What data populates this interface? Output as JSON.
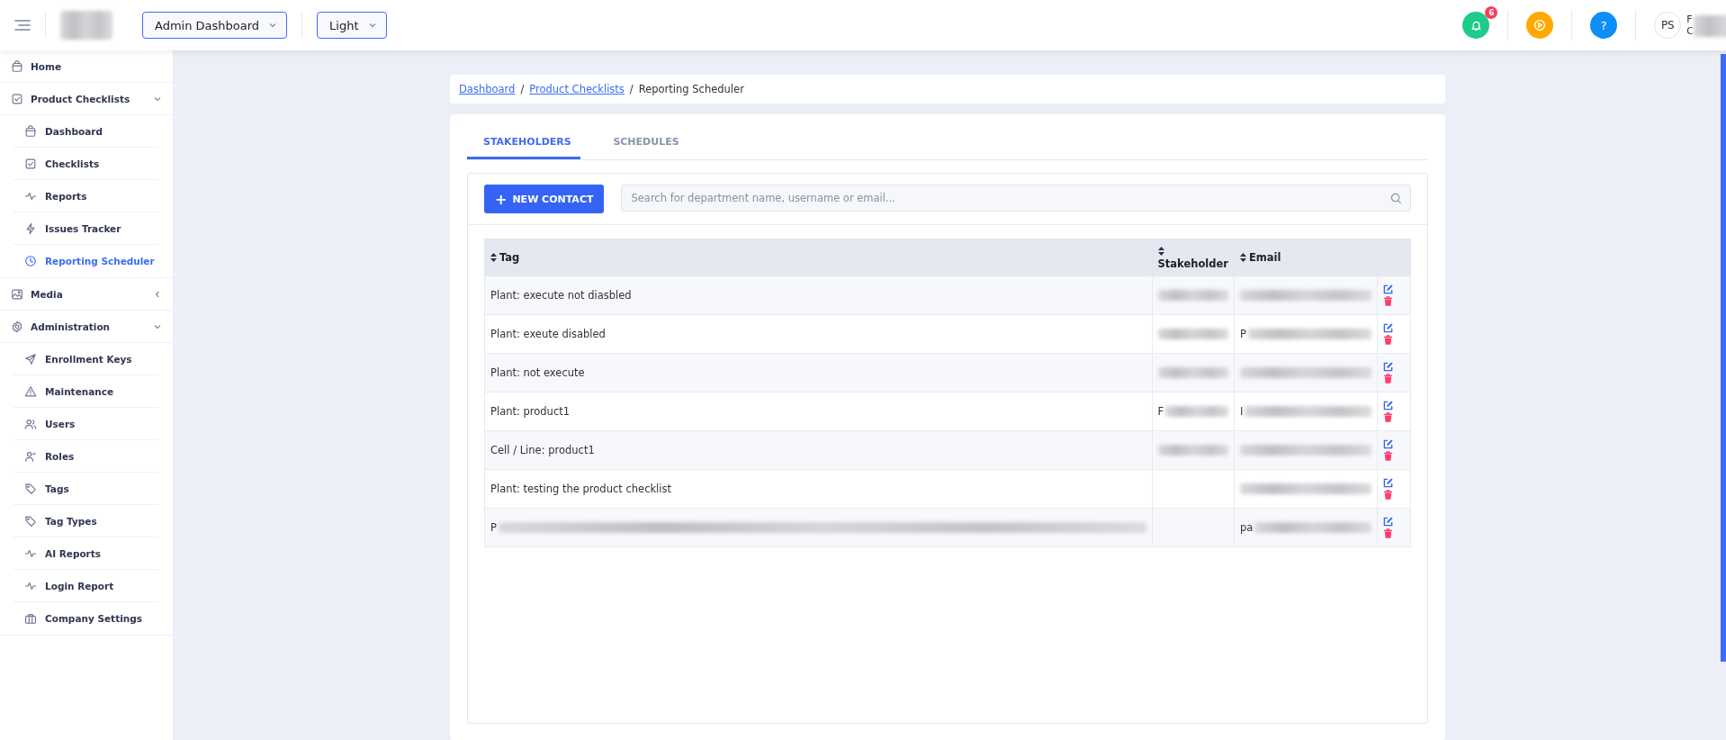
{
  "topbar": {
    "logo": {
      "blurred": true
    },
    "dropdowns": [
      {
        "label": "Admin Dashboard"
      },
      {
        "label": "Light"
      }
    ],
    "notifications": {
      "count": "6"
    },
    "help": {
      "label": "?"
    },
    "user": {
      "initials": "PS",
      "name_lines": [
        "F",
        "C"
      ],
      "blurred": true
    }
  },
  "sidebar": {
    "items": [
      {
        "label": "Home",
        "kind": "link",
        "selected": false
      },
      {
        "label": "Product Checklists",
        "kind": "group",
        "expanded": true,
        "children": [
          {
            "label": "Dashboard",
            "selected": false
          },
          {
            "label": "Checklists",
            "selected": false
          },
          {
            "label": "Reports",
            "selected": false
          },
          {
            "label": "Issues Tracker",
            "selected": false
          },
          {
            "label": "Reporting Scheduler",
            "selected": true
          }
        ]
      },
      {
        "label": "Media",
        "kind": "group",
        "expanded": false
      },
      {
        "label": "Administration",
        "kind": "group",
        "expanded": true,
        "children": [
          {
            "label": "Enrollment Keys",
            "selected": false
          },
          {
            "label": "Maintenance",
            "selected": false
          },
          {
            "label": "Users",
            "selected": false
          },
          {
            "label": "Roles",
            "selected": false
          },
          {
            "label": "Tags",
            "selected": false
          },
          {
            "label": "Tag Types",
            "selected": false
          },
          {
            "label": "AI Reports",
            "selected": false
          },
          {
            "label": "Login Report",
            "selected": false
          },
          {
            "label": "Company Settings",
            "selected": false
          }
        ]
      }
    ]
  },
  "breadcrumb": [
    {
      "label": "Dashboard",
      "kind": "link"
    },
    {
      "separator": "/",
      "label": "Product Checklists",
      "kind": "link"
    },
    {
      "separator": "/",
      "label": "Reporting Scheduler",
      "kind": "current"
    }
  ],
  "tabs": [
    {
      "label": "STAKEHOLDERS",
      "selected": true
    },
    {
      "label": "SCHEDULES",
      "selected": false
    }
  ],
  "new_contact_button": {
    "icon": "+",
    "label": "NEW CONTACT"
  },
  "search": {
    "placeholder": "Search for department name, username or email..."
  },
  "table": {
    "columns": [
      {
        "label": "Tag"
      },
      {
        "label": "Stakeholder"
      },
      {
        "label": "Email"
      }
    ],
    "rows": [
      {
        "tag": {
          "text": "Plant: execute not diasbled",
          "blurred": false
        },
        "stakeholder": {
          "blurred": true
        },
        "email": {
          "blurred": true
        }
      },
      {
        "tag": {
          "text": "Plant: exeute disabled",
          "blurred": false
        },
        "stakeholder": {
          "blurred": true
        },
        "email": {
          "text": "P",
          "blurred": true
        }
      },
      {
        "tag": {
          "text": "Plant: not execute",
          "blurred": false
        },
        "stakeholder": {
          "blurred": true
        },
        "email": {
          "blurred": true
        }
      },
      {
        "tag": {
          "text": "Plant: product1",
          "blurred": false
        },
        "stakeholder": {
          "text": "F",
          "blurred": true
        },
        "email": {
          "text": "I",
          "blurred": true
        }
      },
      {
        "tag": {
          "text": "Cell / Line: product1",
          "blurred": false
        },
        "stakeholder": {
          "blurred": true
        },
        "email": {
          "blurred": true
        }
      },
      {
        "tag": {
          "text": "Plant: testing the product checklist",
          "blurred": false
        },
        "stakeholder": {
          "blurred": false
        },
        "email": {
          "blurred": true
        }
      },
      {
        "tag": {
          "text": "P",
          "blurred": true
        },
        "stakeholder": {
          "blurred": false
        },
        "email": {
          "text": "pa",
          "blurred": true
        }
      }
    ]
  }
}
